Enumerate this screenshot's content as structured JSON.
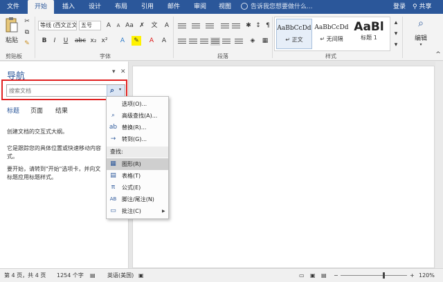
{
  "tabs": [
    "文件",
    "开始",
    "插入",
    "设计",
    "布局",
    "引用",
    "邮件",
    "审阅",
    "视图"
  ],
  "tell_me": "告诉我您想要做什么...",
  "login": "登录",
  "share": "共享",
  "ribbon": {
    "paste": "粘贴",
    "clipboard_group": "剪贴板",
    "font_name": "等线 (西文正文)",
    "font_size": "五号",
    "font_group": "字体",
    "paragraph_group": "段落",
    "styles": [
      {
        "sample": "AaBbCcDd",
        "name": "↵ 正文"
      },
      {
        "sample": "AaBbCcDd",
        "name": "↵ 无间隔"
      },
      {
        "sample": "AaBl",
        "name": "标题 1"
      }
    ],
    "styles_group": "样式",
    "edit": "编辑"
  },
  "nav": {
    "title": "导航",
    "search_placeholder": "搜索文档",
    "tabs": [
      "标题",
      "页面",
      "结果"
    ],
    "text1": "创建文档的交互式大纲。",
    "text2a": "它是跟踪您的具体位置或快速移动内容",
    "text2b": "式。",
    "text3a": "要开始，请转到\"开始\"选项卡，并向文",
    "text3b": "标题应用标题样式。"
  },
  "menu": {
    "items": [
      {
        "icon": "",
        "label": "选项(O)..."
      },
      {
        "icon": "⌕",
        "label": "高级查找(A)..."
      },
      {
        "icon": "ab",
        "label": "替换(R)..."
      },
      {
        "icon": "→",
        "label": "转到(G)..."
      }
    ],
    "header": "查找:",
    "find_items": [
      {
        "icon": "▦",
        "label": "图形(R)"
      },
      {
        "icon": "▤",
        "label": "表格(T)"
      },
      {
        "icon": "π",
        "label": "公式(E)"
      },
      {
        "icon": "AB",
        "label": "脚注/尾注(N)"
      },
      {
        "icon": "▭",
        "label": "批注(C)"
      }
    ]
  },
  "status": {
    "page": "第 4 页，共 4 页",
    "words": "1254 个字",
    "language": "英语(美国)",
    "zoom": "120%"
  },
  "colors": {
    "brand": "#2b579a",
    "highlight_box": "#e02020"
  }
}
